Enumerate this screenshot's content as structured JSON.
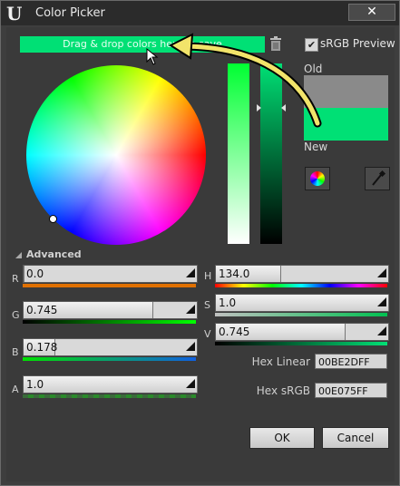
{
  "window": {
    "title": "Color Picker",
    "close_glyph": "✕"
  },
  "logo_text": "U",
  "drop_zone": {
    "text": "Drag & drop colors here to save"
  },
  "srgb_preview": {
    "label": "sRGB Preview",
    "checked": true
  },
  "preview": {
    "old_label": "Old",
    "new_label": "New",
    "old_color": "#8A8A8A",
    "new_color": "#00E075"
  },
  "advanced": {
    "label": "Advanced"
  },
  "channels": {
    "r": {
      "label": "R",
      "value": "0.0",
      "level": 0.0,
      "strip_color": "#e07000"
    },
    "g": {
      "label": "G",
      "value": "0.745",
      "level": 0.745,
      "strip_color": "#00c020"
    },
    "b": {
      "label": "B",
      "value": "0.178",
      "level": 0.178,
      "strip_color": "#1060e0"
    },
    "a": {
      "label": "A",
      "value": "1.0",
      "level": 1.0,
      "strip_color": "#2a8a2a"
    },
    "h": {
      "label": "H",
      "value": "134.0",
      "level": 0.372,
      "strip_color": "rainbow"
    },
    "s": {
      "label": "S",
      "value": "1.0",
      "level": 1.0,
      "strip_color": "#00c050"
    },
    "v": {
      "label": "V",
      "value": "0.745",
      "level": 0.745,
      "strip_color": "#00c050"
    }
  },
  "hex": {
    "linear_label": "Hex Linear",
    "linear_value": "00BE2DFF",
    "srgb_label": "Hex sRGB",
    "srgb_value": "00E075FF"
  },
  "buttons": {
    "ok": "OK",
    "cancel": "Cancel"
  },
  "colors": {
    "accent": "#00E075",
    "background": "#3A3A3A",
    "titlebar": "#2B2B2B"
  }
}
